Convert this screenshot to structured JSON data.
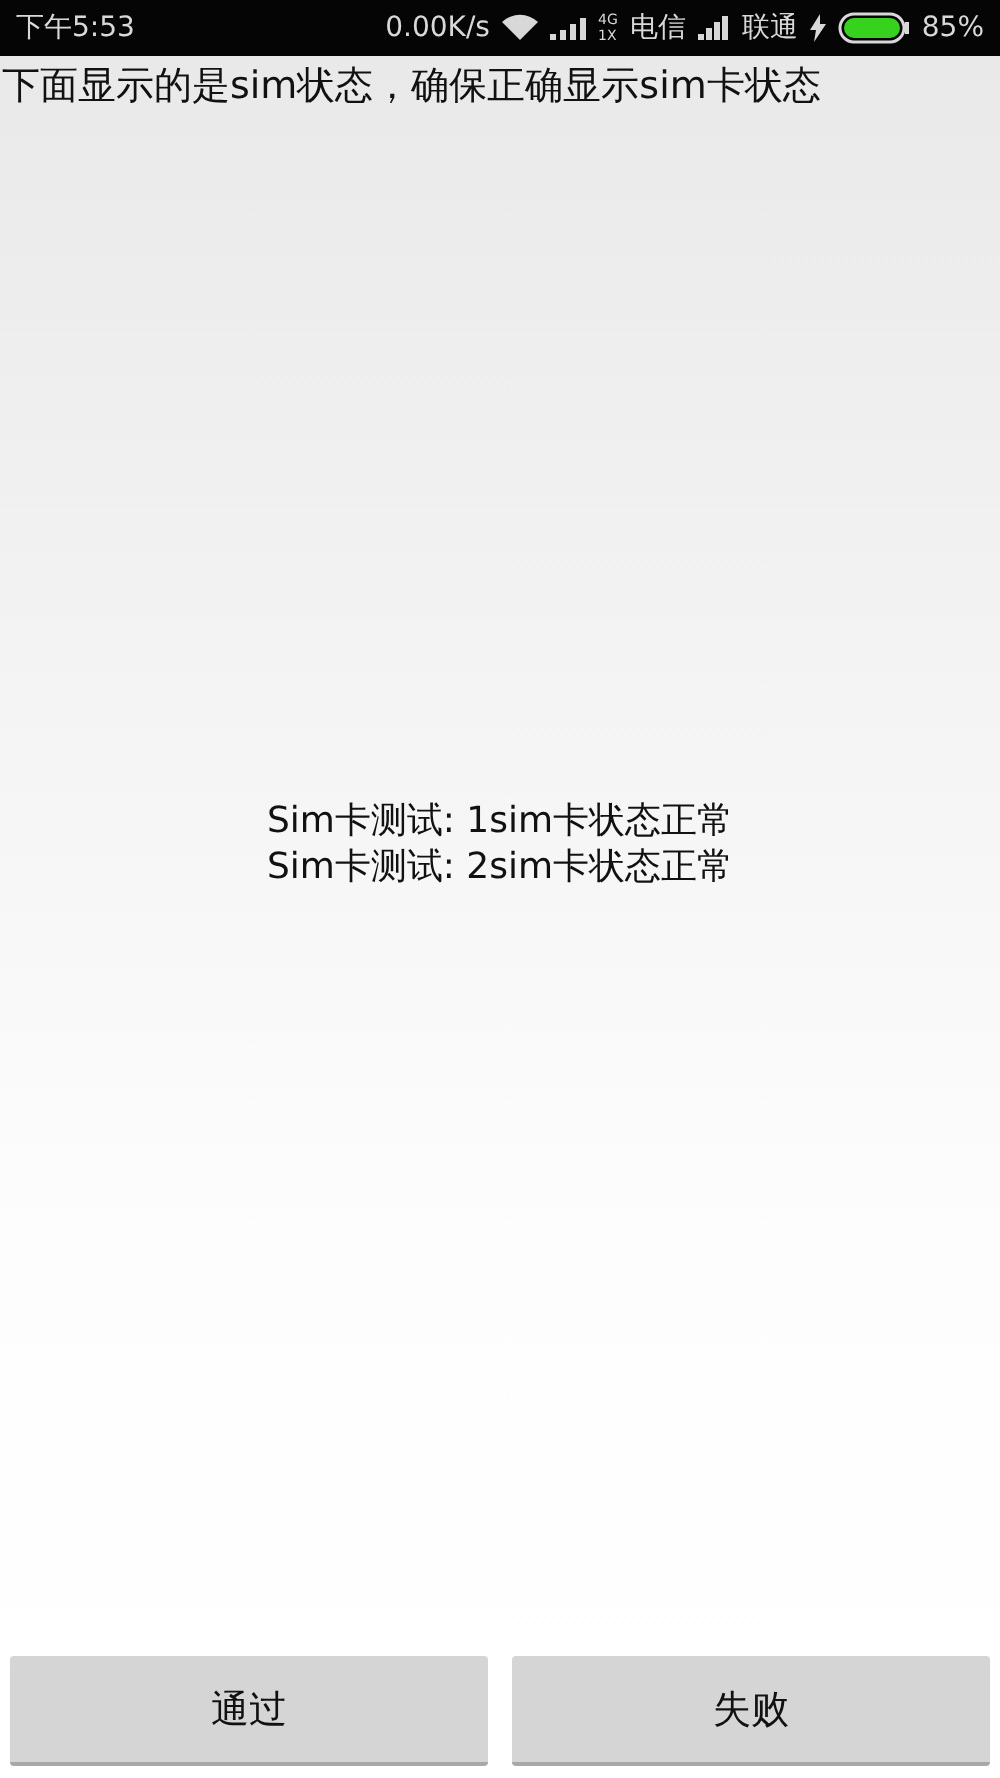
{
  "status_bar": {
    "time": "下午5:53",
    "speed": "0.00K/s",
    "network_top": "4G",
    "network_bottom": "1X",
    "carrier_1": "电信",
    "carrier_2": "联通",
    "battery": "85%"
  },
  "instruction": "下面显示的是sim状态，确保正确显示sim卡状态",
  "results": [
    "Sim卡测试: 1sim卡状态正常",
    "Sim卡测试: 2sim卡状态正常"
  ],
  "buttons": [
    {
      "label": "通过"
    },
    {
      "label": "失败"
    }
  ]
}
